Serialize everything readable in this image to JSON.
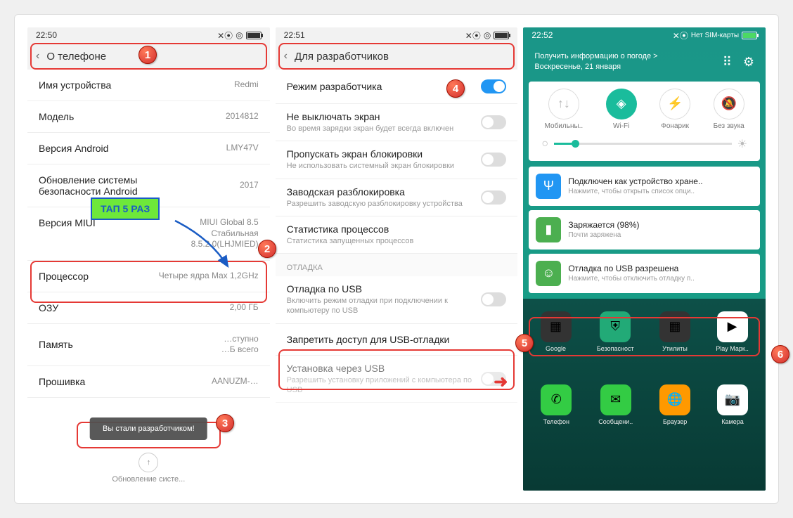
{
  "annotations": {
    "tap_label": "ТАП 5 РАЗ",
    "toast": "Вы стали разработчиком!"
  },
  "phone1": {
    "status_time": "22:50",
    "header_title": "О телефоне",
    "rows": {
      "device_name": {
        "label": "Имя устройства",
        "value": "Redmi"
      },
      "model": {
        "label": "Модель",
        "value": "2014812"
      },
      "android_version": {
        "label": "Версия Android",
        "value": "LMY47V"
      },
      "security_patch": {
        "label": "Обновление системы безопасности Android",
        "value": "2017"
      },
      "miui_version": {
        "label": "Версия MIUI",
        "value_line1": "MIUI Global 8.5",
        "value_line2": "Стабильная",
        "value_line3": "8.5.2.0(LHJMIED)"
      },
      "cpu": {
        "label": "Процессор",
        "value": "Четыре ядра Max 1,2GHz"
      },
      "ram": {
        "label": "ОЗУ",
        "value": "2,00 ГБ"
      },
      "storage": {
        "label": "Память",
        "value_line1": "…ступно",
        "value_line2": "…Б всего"
      },
      "firmware": {
        "label": "Прошивка",
        "value": "AANUZM-…"
      }
    },
    "update_text": "Обновление систе..."
  },
  "phone2": {
    "status_time": "22:51",
    "header_title": "Для разработчиков",
    "dev_mode": {
      "label": "Режим разработчика"
    },
    "keep_screen": {
      "title": "Не выключать экран",
      "sub": "Во время зарядки экран будет всегда включен"
    },
    "skip_lock": {
      "title": "Пропускать экран блокировки",
      "sub": "Не использовать системный экран блокировки"
    },
    "oem_unlock": {
      "title": "Заводская разблокировка",
      "sub": "Разрешить заводскую разблокировку устройства"
    },
    "proc_stats": {
      "title": "Статистика процессов",
      "sub": "Статистика запущенных процессов"
    },
    "section_debug": "ОТЛАДКА",
    "usb_debug": {
      "title": "Отладка по USB",
      "sub": "Включить режим отладки при подключении к компьютеру по USB"
    },
    "revoke_usb": {
      "title": "Запретить доступ для USB-отладки"
    },
    "install_usb": {
      "title": "Установка через USB",
      "sub": "Разрешить установку приложений с компьютера по USB"
    }
  },
  "phone3": {
    "status_time": "22:52",
    "status_sim": "Нет SIM-карты",
    "weather_line1": "Получить информацию о погоде >",
    "weather_line2": "Воскресенье, 21 января",
    "qs": {
      "mobile": "Мобильны..",
      "wifi": "Wi-Fi",
      "torch": "Фонарик",
      "silent": "Без звука"
    },
    "notifs": {
      "usb_storage": {
        "title": "Подключен как устройство хране..",
        "sub": "Нажмите, чтобы открыть список опци.."
      },
      "charging": {
        "title": "Заряжается (98%)",
        "sub": "Почти заряжена"
      },
      "usb_debug": {
        "title": "Отладка по USB разрешена",
        "sub": "Нажмите, чтобы отключить отладку п.."
      }
    },
    "apps": {
      "google": "Google",
      "security": "Безопасност",
      "tools": "Утилиты",
      "play": "Play Марк..",
      "phone": "Телефон",
      "messages": "Сообщени..",
      "browser": "Браузер",
      "camera": "Камера"
    }
  }
}
